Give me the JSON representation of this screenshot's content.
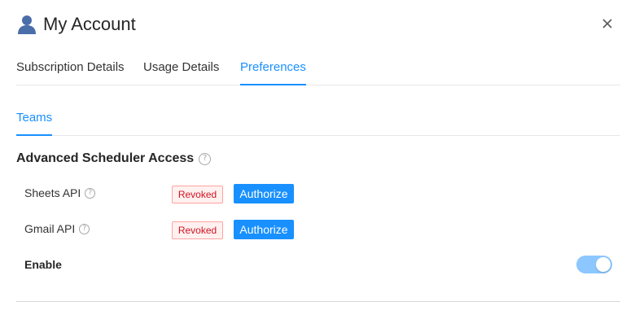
{
  "header": {
    "title": "My Account",
    "icon": "user-icon"
  },
  "close_icon": "close-icon",
  "main_tabs": [
    {
      "label": "Subscription Details",
      "active": false
    },
    {
      "label": "Usage Details",
      "active": false
    },
    {
      "label": "Preferences",
      "active": true
    }
  ],
  "sub_tabs": [
    {
      "label": "Teams",
      "active": true
    }
  ],
  "section": {
    "title": "Advanced Scheduler Access",
    "help_glyph": "?",
    "rows": [
      {
        "label": "Sheets API",
        "help_glyph": "?",
        "status": "Revoked",
        "action": "Authorize"
      },
      {
        "label": "Gmail API",
        "help_glyph": "?",
        "status": "Revoked",
        "action": "Authorize"
      }
    ],
    "enable": {
      "label": "Enable",
      "on": true
    }
  },
  "colors": {
    "accent": "#1890ff",
    "revoked_text": "#cf1322",
    "revoked_border": "#ffa39e",
    "revoked_bg": "#fff1f0",
    "switch_on": "#8cc8ff"
  }
}
